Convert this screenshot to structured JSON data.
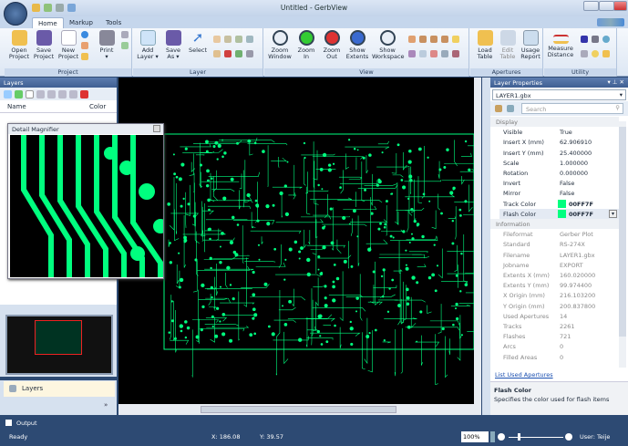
{
  "window": {
    "title": "Untitled - GerbView"
  },
  "tabs": [
    {
      "label": "Home",
      "active": true
    },
    {
      "label": "Markup"
    },
    {
      "label": "Tools"
    }
  ],
  "ribbon": {
    "groups": [
      {
        "label": "Project",
        "buttons": [
          "Open\nProject",
          "Save\nProject",
          "New\nProject",
          "Print\n▾"
        ]
      },
      {
        "label": "Layer",
        "buttons": [
          "Add\nLayer ▾",
          "Save\nAs ▾",
          "Select"
        ]
      },
      {
        "label": "View",
        "buttons": [
          "Zoom\nWindow",
          "Zoom\nIn",
          "Zoom\nOut",
          "Show\nExtents",
          "Show\nWorkspace"
        ]
      },
      {
        "label": "Apertures",
        "buttons": [
          "Load\nTable",
          "Edit\nTable",
          "Usage\nReport"
        ]
      },
      {
        "label": "Utility",
        "buttons": [
          "Measure\nDistance"
        ]
      }
    ]
  },
  "layers_panel": {
    "title": "Layers",
    "col_name": "Name",
    "col_color": "Color",
    "bottom_button": "Layers"
  },
  "magnifier": {
    "title": "Detail Magnifier"
  },
  "layer_props": {
    "title": "Layer Properties",
    "selected": "LAYER1.gbx",
    "search_placeholder": "Search",
    "display_cat": "Display",
    "display": [
      [
        "Visible",
        "True"
      ],
      [
        "Insert X (mm)",
        "62.906910"
      ],
      [
        "Insert Y (mm)",
        "25.400000"
      ],
      [
        "Scale",
        "1.000000"
      ],
      [
        "Rotation",
        "0.000000"
      ],
      [
        "Invert",
        "False"
      ],
      [
        "Mirror",
        "False"
      ],
      [
        "Track Color",
        "00FF7F"
      ],
      [
        "Flash Color",
        "00FF7F"
      ]
    ],
    "info_cat": "Information",
    "info": [
      [
        "Fileformat",
        "Gerber Plot"
      ],
      [
        "Standard",
        "RS-274X"
      ],
      [
        "Filename",
        "LAYER1.gbx"
      ],
      [
        "Jobname",
        "EXPORT"
      ],
      [
        "Extents X (mm)",
        "160.020000"
      ],
      [
        "Extents Y (mm)",
        "99.974400"
      ],
      [
        "X Origin (mm)",
        "216.103200"
      ],
      [
        "Y Origin (mm)",
        "200.837800"
      ],
      [
        "Used Apertures",
        "14"
      ],
      [
        "Tracks",
        "2261"
      ],
      [
        "Flashes",
        "721"
      ],
      [
        "Arcs",
        "0"
      ],
      [
        "Filled Areas",
        "0"
      ]
    ],
    "link": "List Used Apertures",
    "desc_title": "Flash Color",
    "desc_text": "Specifies the color used for flash items"
  },
  "colors": {
    "trace": "#00FF7F",
    "accent": "#2d4a73"
  },
  "output": {
    "label": "Output"
  },
  "status": {
    "ready": "Ready",
    "x": "X: 186.08",
    "y": "Y: 39.57",
    "zoom": "100%",
    "user": "User: Teije"
  }
}
